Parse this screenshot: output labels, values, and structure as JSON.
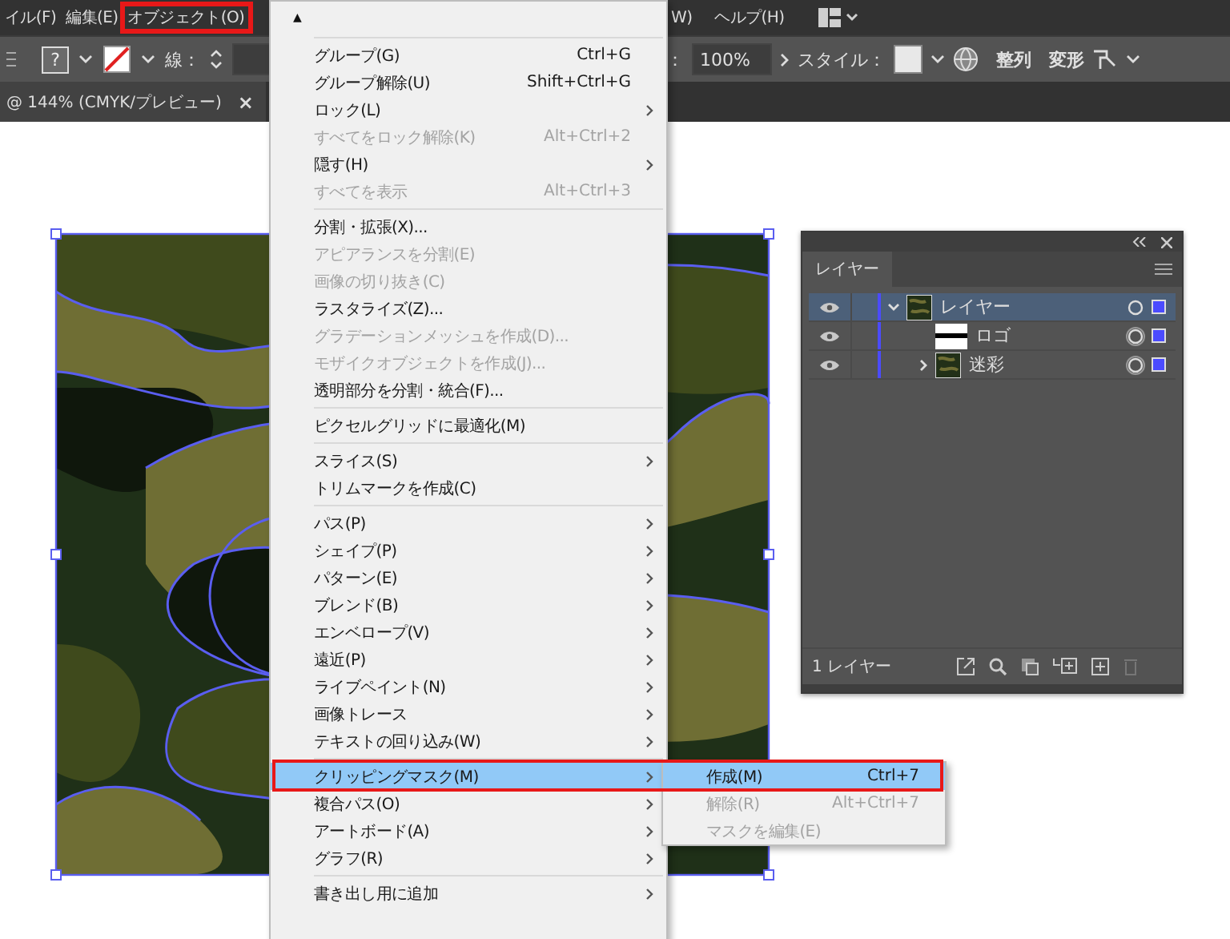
{
  "menubar": {
    "items": [
      {
        "label": "イル(F)",
        "selected": false
      },
      {
        "label": "編集(E)",
        "selected": false
      },
      {
        "label": "オブジェクト(O)",
        "selected": true
      }
    ],
    "right_items": [
      "W)",
      "ヘルプ(H)"
    ]
  },
  "control_bar": {
    "fill_glyph": "?",
    "stroke_label": "線：",
    "opacity_colon": "：",
    "opacity_value": "100%",
    "style_label": "スタイル：",
    "align": "整列",
    "transform": "変形"
  },
  "document_tab": {
    "title": "@ 144% (CMYK/プレビュー)",
    "close": "×"
  },
  "object_menu": {
    "scroll_arrow": "▲",
    "groups": [
      [
        {
          "label": "グループ(G)",
          "shortcut": "Ctrl+G",
          "submenu": false,
          "disabled": false,
          "selected": false
        },
        {
          "label": "グループ解除(U)",
          "shortcut": "Shift+Ctrl+G",
          "submenu": false,
          "disabled": false,
          "selected": false
        },
        {
          "label": "ロック(L)",
          "submenu": true,
          "disabled": false,
          "selected": false
        },
        {
          "label": "すべてをロック解除(K)",
          "shortcut": "Alt+Ctrl+2",
          "submenu": false,
          "disabled": true,
          "selected": false
        },
        {
          "label": "隠す(H)",
          "submenu": true,
          "disabled": false,
          "selected": false
        },
        {
          "label": "すべてを表示",
          "shortcut": "Alt+Ctrl+3",
          "submenu": false,
          "disabled": true,
          "selected": false
        }
      ],
      [
        {
          "label": "分割・拡張(X)...",
          "submenu": false,
          "disabled": false,
          "selected": false
        },
        {
          "label": "アピアランスを分割(E)",
          "submenu": false,
          "disabled": true,
          "selected": false
        },
        {
          "label": "画像の切り抜き(C)",
          "submenu": false,
          "disabled": true,
          "selected": false
        },
        {
          "label": "ラスタライズ(Z)...",
          "submenu": false,
          "disabled": false,
          "selected": false
        },
        {
          "label": "グラデーションメッシュを作成(D)...",
          "submenu": false,
          "disabled": true,
          "selected": false
        },
        {
          "label": "モザイクオブジェクトを作成(J)...",
          "submenu": false,
          "disabled": true,
          "selected": false
        },
        {
          "label": "透明部分を分割・統合(F)...",
          "submenu": false,
          "disabled": false,
          "selected": false
        }
      ],
      [
        {
          "label": "ピクセルグリッドに最適化(M)",
          "submenu": false,
          "disabled": false,
          "selected": false
        }
      ],
      [
        {
          "label": "スライス(S)",
          "submenu": true,
          "disabled": false,
          "selected": false
        },
        {
          "label": "トリムマークを作成(C)",
          "submenu": false,
          "disabled": false,
          "selected": false
        }
      ],
      [
        {
          "label": "パス(P)",
          "submenu": true,
          "disabled": false,
          "selected": false
        },
        {
          "label": "シェイプ(P)",
          "submenu": true,
          "disabled": false,
          "selected": false
        },
        {
          "label": "パターン(E)",
          "submenu": true,
          "disabled": false,
          "selected": false
        },
        {
          "label": "ブレンド(B)",
          "submenu": true,
          "disabled": false,
          "selected": false
        },
        {
          "label": "エンベロープ(V)",
          "submenu": true,
          "disabled": false,
          "selected": false
        },
        {
          "label": "遠近(P)",
          "submenu": true,
          "disabled": false,
          "selected": false
        },
        {
          "label": "ライブペイント(N)",
          "submenu": true,
          "disabled": false,
          "selected": false
        },
        {
          "label": "画像トレース",
          "submenu": true,
          "disabled": false,
          "selected": false
        },
        {
          "label": "テキストの回り込み(W)",
          "submenu": true,
          "disabled": false,
          "selected": false
        }
      ],
      [
        {
          "label": "クリッピングマスク(M)",
          "submenu": true,
          "disabled": false,
          "selected": true
        },
        {
          "label": "複合パス(O)",
          "submenu": true,
          "disabled": false,
          "selected": false
        },
        {
          "label": "アートボード(A)",
          "submenu": true,
          "disabled": false,
          "selected": false
        },
        {
          "label": "グラフ(R)",
          "submenu": true,
          "disabled": false,
          "selected": false
        }
      ],
      [
        {
          "label": "書き出し用に追加",
          "submenu": true,
          "disabled": false,
          "selected": false
        }
      ]
    ]
  },
  "clipping_submenu": {
    "items": [
      {
        "label": "作成(M)",
        "shortcut": "Ctrl+7",
        "disabled": false,
        "selected": true
      },
      {
        "label": "解除(R)",
        "shortcut": "Alt+Ctrl+7",
        "disabled": true,
        "selected": false
      },
      {
        "label": "マスクを編集(E)",
        "disabled": true,
        "selected": false
      }
    ]
  },
  "layers_panel": {
    "tab": "レイヤー",
    "layers": [
      {
        "name": "レイヤー",
        "visible": true,
        "selected": true,
        "expanded": true,
        "kind": "camouflage",
        "children": [
          {
            "name": "ロゴ",
            "visible": true,
            "selected": false,
            "kind": "logo"
          },
          {
            "name": "迷彩",
            "visible": true,
            "selected": false,
            "expanded": false,
            "kind": "camouflage"
          }
        ]
      }
    ],
    "footer": "1 レイヤー"
  }
}
